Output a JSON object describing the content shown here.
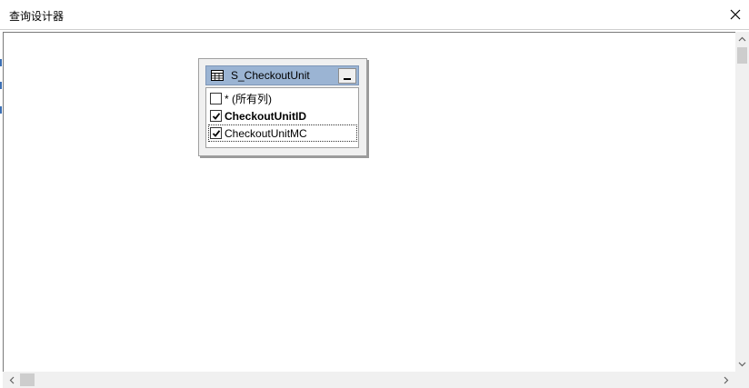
{
  "window": {
    "title": "查询设计器"
  },
  "table": {
    "name": "S_CheckoutUnit",
    "columns": [
      {
        "label": "* (所有列)",
        "checked": false,
        "bold": false
      },
      {
        "label": "CheckoutUnitID",
        "checked": true,
        "bold": true
      },
      {
        "label": "CheckoutUnitMC",
        "checked": true,
        "bold": false
      }
    ]
  },
  "colors": {
    "table_header": "#9bb4d3",
    "box_background": "#f0f0f0"
  },
  "icons": {
    "close": "close-icon",
    "table": "table-grid-icon",
    "minimize": "minimize-icon",
    "check": "checkmark-icon"
  }
}
